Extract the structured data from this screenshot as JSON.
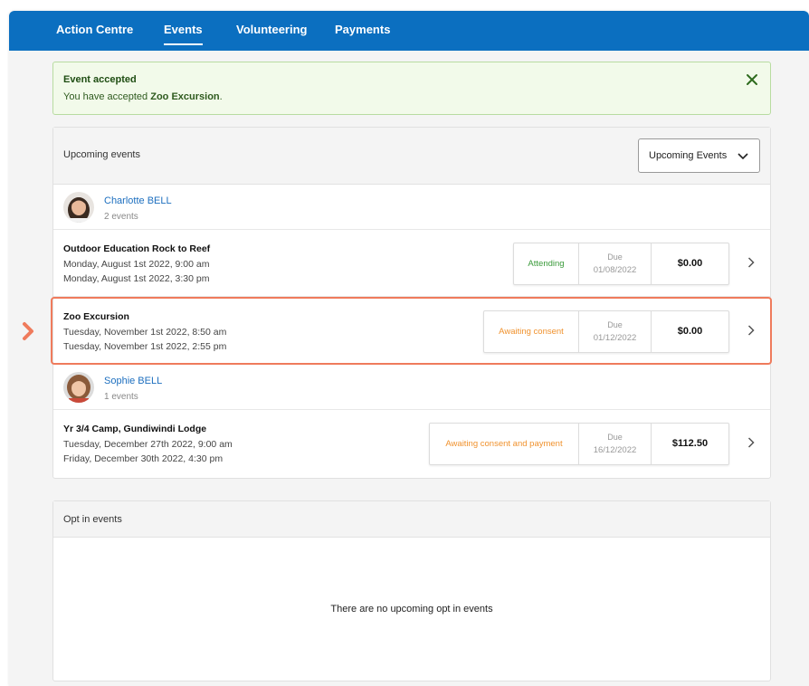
{
  "nav": {
    "items": [
      {
        "label": "Action Centre"
      },
      {
        "label": "Events"
      },
      {
        "label": "Volunteering"
      },
      {
        "label": "Payments"
      }
    ],
    "active": "Events"
  },
  "alert": {
    "title": "Event accepted",
    "message_prefix": "You have accepted ",
    "event_name": "Zoo Excursion",
    "message_suffix": "."
  },
  "upcoming": {
    "title": "Upcoming events",
    "dropdown_selected": "Upcoming Events",
    "people": [
      {
        "name": "Charlotte BELL",
        "count": "2 events",
        "events": [
          {
            "title": "Outdoor Education Rock to Reef",
            "start": "Monday, August 1st 2022, 9:00 am",
            "end": "Monday, August 1st 2022, 3:30 pm",
            "status": "Attending",
            "due_label": "Due",
            "due_date": "01/08/2022",
            "amount": "$0.00"
          },
          {
            "title": "Zoo Excursion",
            "start": "Tuesday, November 1st 2022, 8:50 am",
            "end": "Tuesday, November 1st 2022, 2:55 pm",
            "status": "Awaiting consent",
            "due_label": "Due",
            "due_date": "01/12/2022",
            "amount": "$0.00"
          }
        ]
      },
      {
        "name": "Sophie BELL",
        "count": "1 events",
        "events": [
          {
            "title": "Yr 3/4 Camp, Gundiwindi Lodge",
            "start": "Tuesday, December 27th 2022, 9:00 am",
            "end": "Friday, December 30th 2022, 4:30 pm",
            "status": "Awaiting consent and payment",
            "due_label": "Due",
            "due_date": "16/12/2022",
            "amount": "$112.50"
          }
        ]
      }
    ]
  },
  "optin": {
    "title": "Opt in events",
    "empty_message": "There are no upcoming opt in events"
  },
  "colors": {
    "nav_bg": "#0b6fc0",
    "link": "#1d6fbf",
    "status_attending": "#3a9a3a",
    "status_awaiting": "#f0922e",
    "highlight": "#ef7b5c",
    "alert_bg": "#f2faea"
  },
  "icons": {
    "alert_close": "close-icon",
    "dropdown": "chevron-down-icon",
    "row": "chevron-right-icon",
    "marker": "chevron-right-icon"
  }
}
